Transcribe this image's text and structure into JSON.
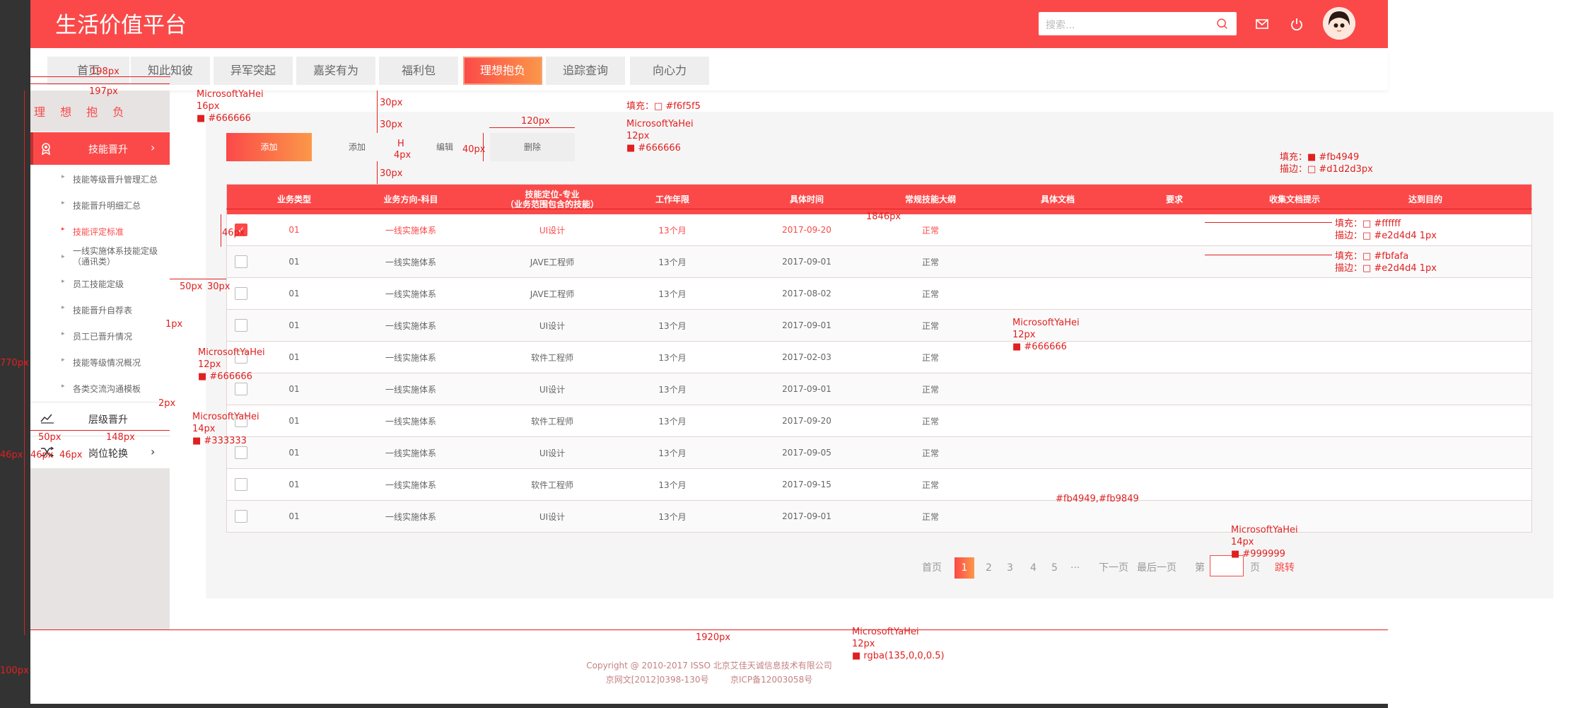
{
  "app": {
    "title": "生活价值平台",
    "search_placeholder": "搜索...",
    "accent": "#fb4949",
    "accent_gradient": [
      "#fb4949",
      "#fb9849"
    ]
  },
  "nav": {
    "tabs": [
      {
        "label": "首页"
      },
      {
        "label": "知此知彼"
      },
      {
        "label": "异军突起"
      },
      {
        "label": "嘉奖有为"
      },
      {
        "label": "福利包"
      },
      {
        "label": "理想抱负",
        "active": true
      },
      {
        "label": "追踪查询"
      },
      {
        "label": "向心力"
      }
    ]
  },
  "sidebar": {
    "title": "理 想 抱 负",
    "sections": [
      {
        "label": "技能晋升",
        "icon": "badge-icon",
        "active": true
      },
      {
        "label": "层级晋升",
        "icon": "trend-line-icon"
      },
      {
        "label": "岗位轮换",
        "icon": "shuffle-icon"
      }
    ],
    "sub_items": [
      "技能等级晋升管理汇总",
      "技能晋升明细汇总",
      "技能评定标准",
      "一线实施体系技能定级\n（通讯类）",
      "员工技能定级",
      "技能晋升自荐表",
      "员工已晋升情况",
      "技能等级情况概况",
      "各类交流沟通模板"
    ],
    "active_sub_index": 2
  },
  "toolbar": {
    "buttons": [
      "添加",
      "添加",
      "编辑",
      "删除"
    ]
  },
  "table": {
    "columns": [
      "业务类型",
      "业务方向-科目",
      "技能定位-专业\n（业务范围包含的技能）",
      "工作年限",
      "具体时间",
      "常规技能大纲",
      "具体文档",
      "要求",
      "收集文档提示",
      "达到目的"
    ],
    "rows": [
      {
        "checked": true,
        "cells": [
          "01",
          "一线实施体系",
          "UI设计",
          "13个月",
          "2017-09-20",
          "正常"
        ]
      },
      {
        "checked": false,
        "cells": [
          "01",
          "一线实施体系",
          "JAVE工程师",
          "13个月",
          "2017-09-01",
          "正常"
        ]
      },
      {
        "checked": false,
        "cells": [
          "01",
          "一线实施体系",
          "JAVE工程师",
          "13个月",
          "2017-08-02",
          "正常"
        ]
      },
      {
        "checked": false,
        "cells": [
          "01",
          "一线实施体系",
          "UI设计",
          "13个月",
          "2017-09-01",
          "正常"
        ]
      },
      {
        "checked": false,
        "cells": [
          "01",
          "一线实施体系",
          "软件工程师",
          "13个月",
          "2017-02-03",
          "正常"
        ]
      },
      {
        "checked": false,
        "cells": [
          "01",
          "一线实施体系",
          "UI设计",
          "13个月",
          "2017-09-01",
          "正常"
        ]
      },
      {
        "checked": false,
        "cells": [
          "01",
          "一线实施体系",
          "软件工程师",
          "13个月",
          "2017-09-20",
          "正常"
        ]
      },
      {
        "checked": false,
        "cells": [
          "01",
          "一线实施体系",
          "UI设计",
          "13个月",
          "2017-09-05",
          "正常"
        ]
      },
      {
        "checked": false,
        "cells": [
          "01",
          "一线实施体系",
          "软件工程师",
          "13个月",
          "2017-09-15",
          "正常"
        ]
      },
      {
        "checked": false,
        "cells": [
          "01",
          "一线实施体系",
          "UI设计",
          "13个月",
          "2017-09-01",
          "正常"
        ]
      }
    ]
  },
  "pager": {
    "first": "首页",
    "pages": [
      "1",
      "2",
      "3",
      "4",
      "5"
    ],
    "current": "1",
    "ellipsis": "···",
    "next": "下一页",
    "last": "最后一页",
    "goto_prefix": "第",
    "goto_suffix": "页",
    "jump": "跳转"
  },
  "footer": {
    "copyright": "Copyright @ 2010-2017 ISSO 北京艾佳天诚信息技术有限公司",
    "icp": "京网文[2012]0398-130号        京ICP备12003058号"
  },
  "annotations": {
    "a1": "198px",
    "a2": "197px",
    "a3": "MicrosoftYaHei\n16px\n■ #666666",
    "a4": "30px",
    "a5": "30px",
    "a6": "30px",
    "a7": "填充：□ #f6f5f5",
    "a8": "120px",
    "a9": "MicrosoftYaHei\n12px\n■ #666666",
    "a10": "4px",
    "a11": "40px",
    "a12": "H",
    "a13": "填充：■ #fb4949\n描边：□ #d1d2d3px",
    "a14": "1846px",
    "a15": "填充：□ #ffffff\n描边：□ #e2d4d4 1px",
    "a16": "填充：□ #fbfafa\n描边：□ #e2d4d4 1px",
    "a17": "46px",
    "a18": "50px",
    "a19": "30px",
    "a20": "1px",
    "a21": "MicrosoftYaHei\n12px\n■ #666666",
    "a22": "MicrosoftYaHei\n12px\n■ #666666",
    "a23": "2px",
    "a24": "MicrosoftYaHei\n14px\n■ #333333",
    "a25": "50px",
    "a26": "148px",
    "a27": "46px",
    "a28": "46px",
    "a29": "770px",
    "a30": "46px",
    "a31": "#fb4949,#fb9849",
    "a32": "MicrosoftYaHei\n14px\n■ #999999",
    "a33": "1920px",
    "a34": "MicrosoftYaHei\n12px\n■ rgba(135,0,0,0.5)",
    "a35": "100px"
  }
}
